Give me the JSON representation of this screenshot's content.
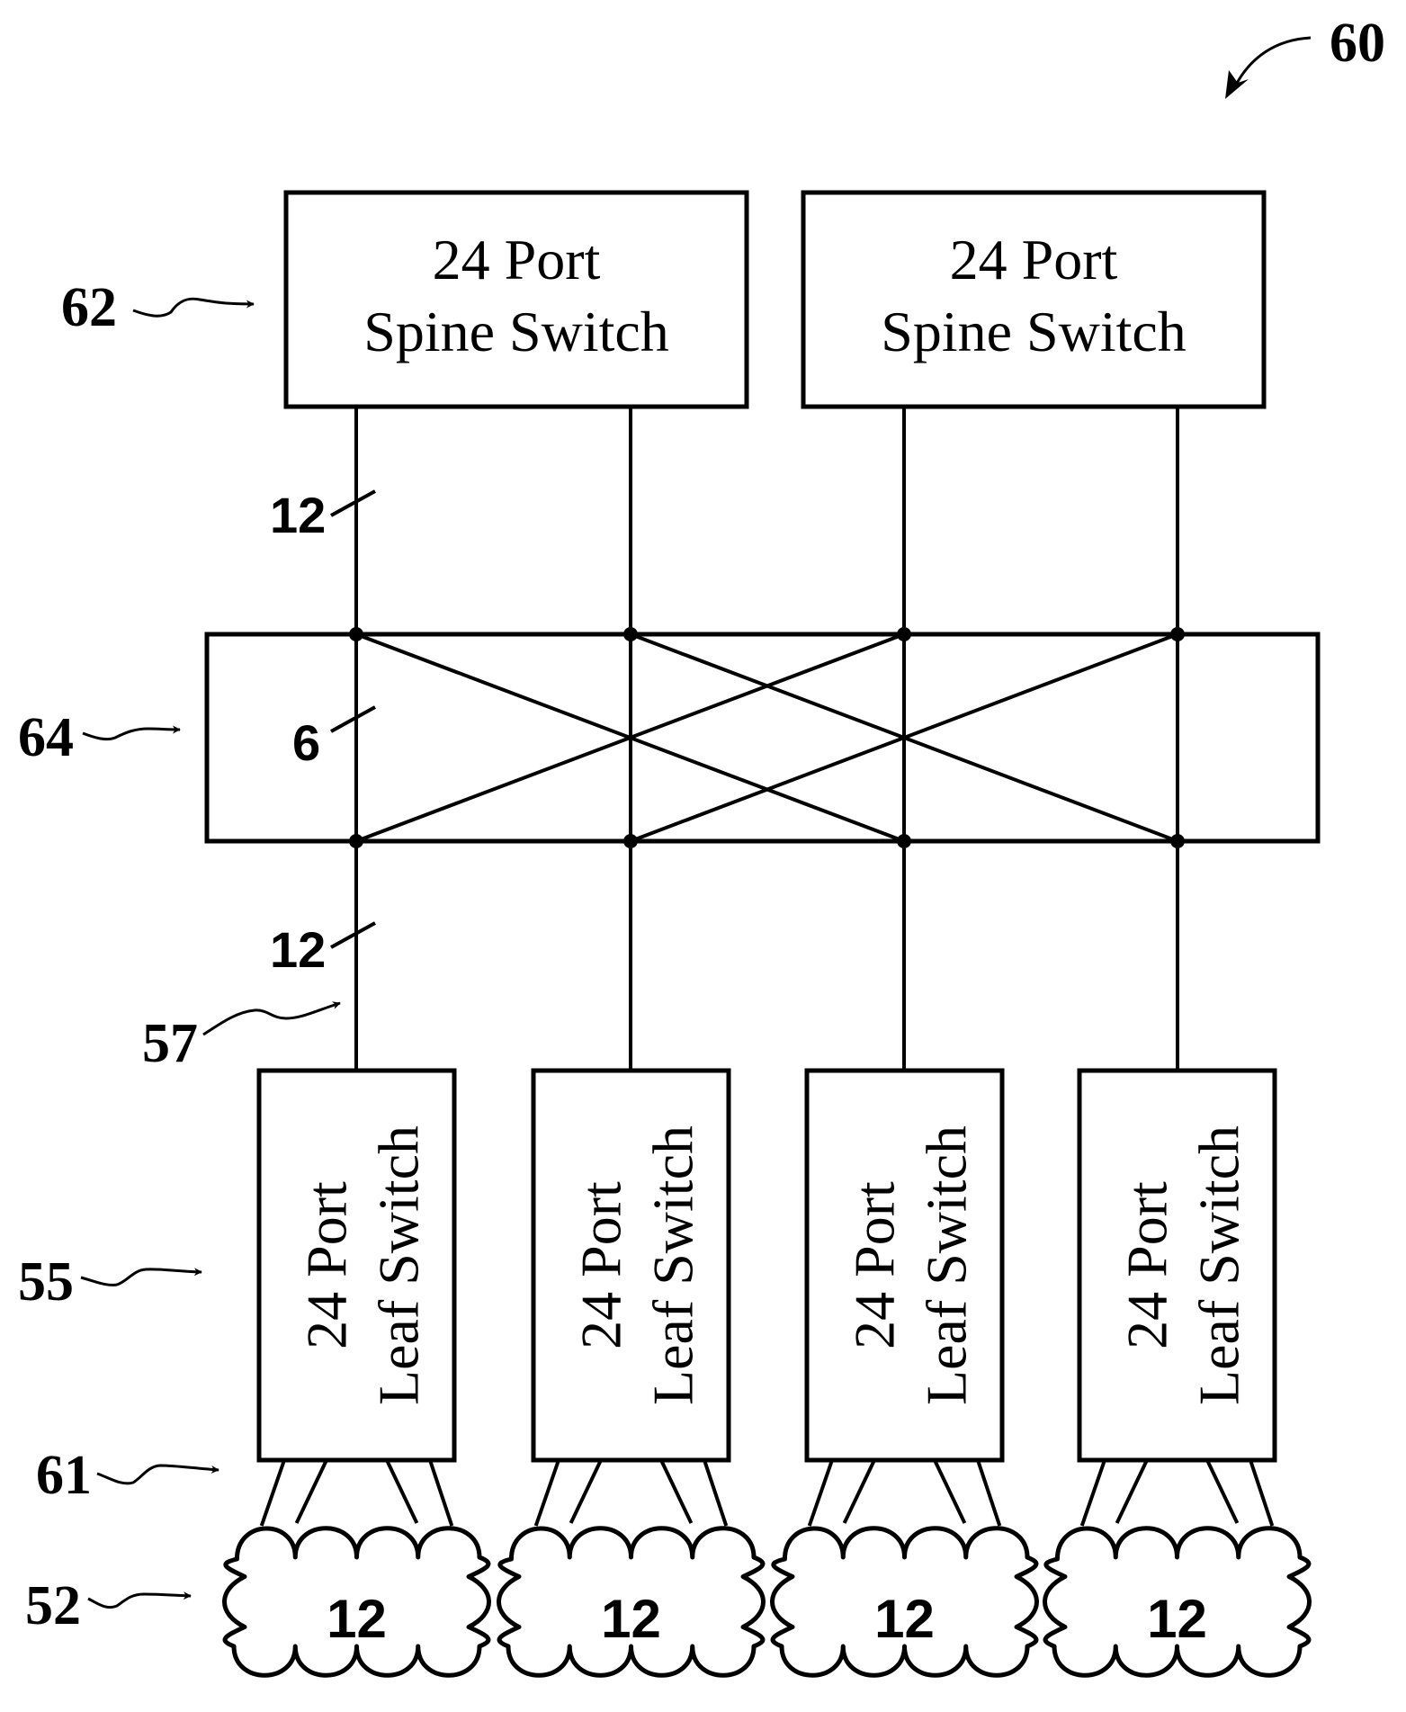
{
  "figure": {
    "reference_numeral": "60",
    "colors": {
      "ink": "#000000",
      "paper": "#ffffff"
    }
  },
  "spine_switches": {
    "ref_label": "62",
    "items": [
      {
        "line1": "24 Port",
        "line2": "Spine Switch"
      },
      {
        "line1": "24 Port",
        "line2": "Spine Switch"
      }
    ]
  },
  "uplink_count": {
    "label": "12"
  },
  "crossbar": {
    "ref_label": "64",
    "link_count": "6"
  },
  "downlink_count": {
    "label": "12"
  },
  "link_ref_label": "57",
  "leaf_switches": {
    "ref_label": "55",
    "items": [
      {
        "line1": "24 Port",
        "line2": "Leaf Switch"
      },
      {
        "line1": "24 Port",
        "line2": "Leaf Switch"
      },
      {
        "line1": "24 Port",
        "line2": "Leaf Switch"
      },
      {
        "line1": "24 Port",
        "line2": "Leaf Switch"
      }
    ]
  },
  "host_links_ref_label": "61",
  "host_groups": {
    "ref_label": "52",
    "items": [
      {
        "count": "12"
      },
      {
        "count": "12"
      },
      {
        "count": "12"
      },
      {
        "count": "12"
      }
    ]
  }
}
